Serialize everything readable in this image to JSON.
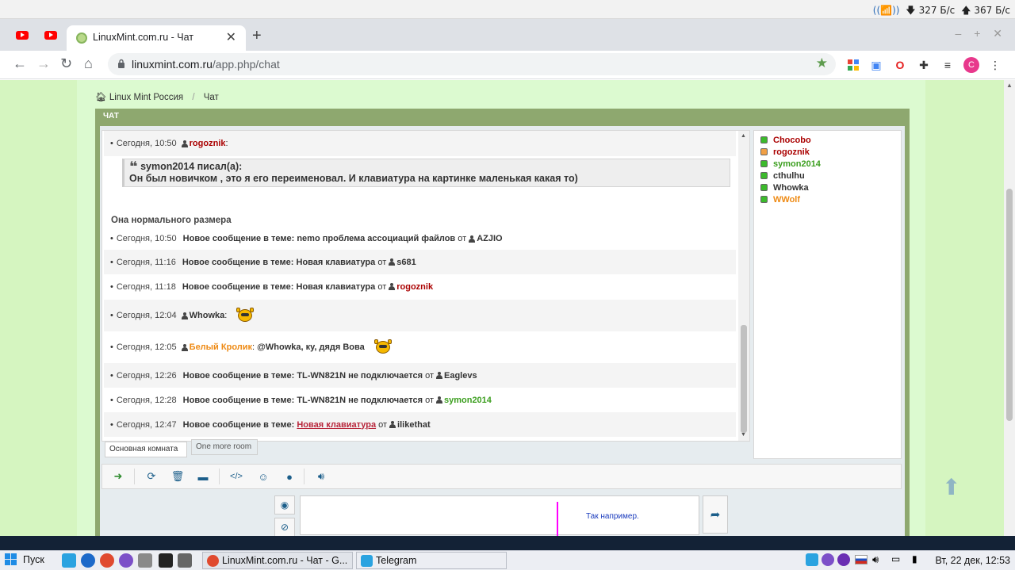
{
  "system": {
    "net_down": "327 Б/с",
    "net_up": "367 Б/с"
  },
  "browser": {
    "tab_title": "LinuxMint.com.ru - Чат",
    "url_host": "linuxmint.com.ru",
    "url_path": "/app.php/chat",
    "profile_letter": "C"
  },
  "breadcrumb": {
    "home": "Linux Mint Россия",
    "current": "Чат"
  },
  "chat": {
    "header": "ЧАТ",
    "messages": [
      {
        "time": "Сегодня, 10:50",
        "user": "rogoznik",
        "suffix": ":"
      },
      {
        "quote_author": "symon2014 писал(а):",
        "quote_text": "Он был новичком , это я его переименовал. И клавиатура на картинке маленькая какая то)"
      },
      {
        "standalone": "Она нормального размера"
      },
      {
        "time": "Сегодня, 10:50",
        "prefix": "Новое сообщение в теме:",
        "topic": "nemo проблема ассоциаций файлов",
        "from": "от",
        "user": "AZJIO"
      },
      {
        "time": "Сегодня, 11:16",
        "prefix": "Новое сообщение в теме:",
        "topic": "Новая клавиатура",
        "from": "от",
        "user": "s681"
      },
      {
        "time": "Сегодня, 11:18",
        "prefix": "Новое сообщение в теме:",
        "topic": "Новая клавиатура",
        "from": "от",
        "user": "rogoznik"
      },
      {
        "time": "Сегодня, 12:04",
        "user": "Whowka",
        "suffix": ":"
      },
      {
        "time": "Сегодня, 12:05",
        "user": "Белый Кролик",
        "suffix": ":",
        "text": "@Whowka, ку, дядя Вова"
      },
      {
        "time": "Сегодня, 12:26",
        "prefix": "Новое сообщение в теме:",
        "topic": "TL-WN821N не подключается",
        "from": "от",
        "user": "Eaglevs"
      },
      {
        "time": "Сегодня, 12:28",
        "prefix": "Новое сообщение в теме:",
        "topic": "TL-WN821N не подключается",
        "from": "от",
        "user": "symon2014"
      },
      {
        "time": "Сегодня, 12:47",
        "prefix": "Новое сообщение в теме:",
        "topic": "Новая клавиатура",
        "from": "от",
        "user": "ilikethat"
      }
    ],
    "rooms": [
      "Основная комната",
      "One more room"
    ],
    "users": [
      {
        "name": "Chocobo",
        "color": "#aa0000",
        "status": "online"
      },
      {
        "name": "rogoznik",
        "color": "#aa0000",
        "status": "away"
      },
      {
        "name": "symon2014",
        "color": "#3b9e1e",
        "status": "online"
      },
      {
        "name": "cthulhu",
        "color": "#333333",
        "status": "online"
      },
      {
        "name": "Whowka",
        "color": "#333333",
        "status": "online"
      },
      {
        "name": "WWolf",
        "color": "#ee8a14",
        "status": "online"
      }
    ],
    "input_hint": "Так например."
  },
  "taskbar": {
    "start": "Пуск",
    "items": [
      "LinuxMint.com.ru - Чат - G...",
      "Telegram"
    ],
    "clock": "Вт, 22 дек, 12:53"
  }
}
